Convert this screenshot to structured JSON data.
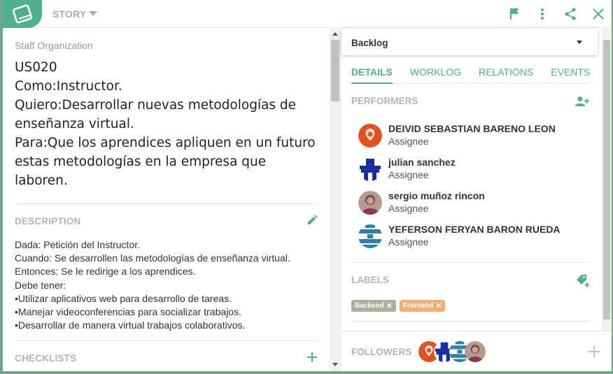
{
  "header": {
    "type_label": "STORY",
    "icons": [
      "book-icon",
      "flag-icon",
      "more-vert-icon",
      "share-icon",
      "close-icon"
    ],
    "accent": "#4fae8c"
  },
  "left": {
    "project": "Staff Organization",
    "story_lines": [
      "US020",
      "Como:Instructor.",
      "Quiero:Desarrollar nuevas metodologías de",
      "enseñanza virtual.",
      "Para:Que los aprendices apliquen en un futuro",
      "estas metodologías  en la empresa que",
      "laboren."
    ],
    "description_title": "DESCRIPTION",
    "description_lines": [
      "Dada: Petición del Instructor.",
      "Cuando: Se desarrollen las metodologías de enseñanza virtual.",
      "Entonces: Se le redirige a los aprendices.",
      "Debe tener:",
      "•Utilizar aplicativos web para desarrollo de tareas.",
      "•Manejar videoconferencias para socializar trabajos.",
      "•Desarrollar de manera virtual trabajos colaborativos."
    ],
    "checklists_title": "CHECKLISTS"
  },
  "right": {
    "status": "Backlog",
    "tabs": [
      "DETAILS",
      "WORKLOG",
      "RELATIONS",
      "EVENTS"
    ],
    "performers_title": "PERFORMERS",
    "performers": [
      {
        "name": "DEIVID SEBASTIAN BARENO LEON",
        "role": "Assignee"
      },
      {
        "name": "julian sanchez",
        "role": "Assignee"
      },
      {
        "name": "sergio muñoz rincon",
        "role": "Assignee"
      },
      {
        "name": "YEFERSON FERYAN BARON RUEDA",
        "role": "Assignee"
      }
    ],
    "labels_title": "LABELS",
    "labels": [
      {
        "text": "Backend",
        "color": "#a9b29a"
      },
      {
        "text": "Frontend",
        "color": "#f0b072"
      }
    ],
    "followers_title": "FOLLOWERS"
  }
}
